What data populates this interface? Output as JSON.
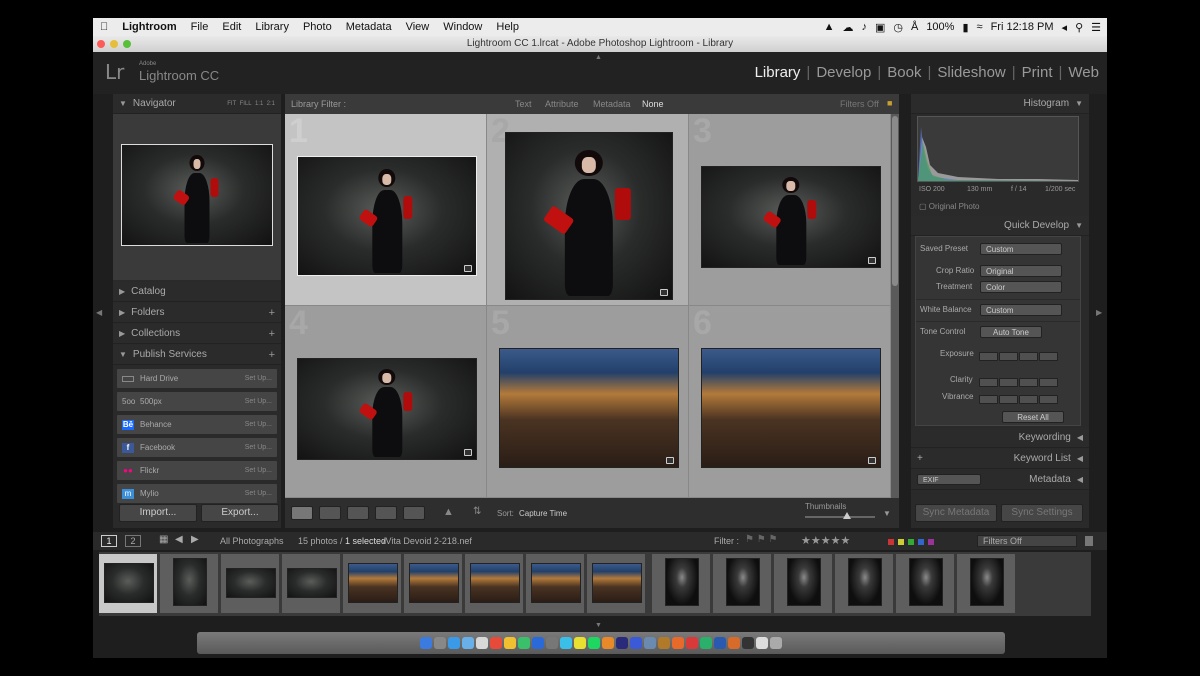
{
  "menubar": {
    "app": "Lightroom",
    "items": [
      "File",
      "Edit",
      "Library",
      "Photo",
      "Metadata",
      "View",
      "Window",
      "Help"
    ],
    "battery": "100%",
    "clock": "Fri 12:18 PM"
  },
  "window_title": "Lightroom CC 1.lrcat - Adobe Photoshop Lightroom - Library",
  "identity": {
    "logo": "Lr",
    "brand_small": "Adobe",
    "product": "Lightroom CC"
  },
  "modules": [
    "Library",
    "Develop",
    "Book",
    "Slideshow",
    "Print",
    "Web"
  ],
  "navigator": {
    "title": "Navigator",
    "zoom_options": [
      "FIT",
      "FILL",
      "1:1",
      "2:1"
    ]
  },
  "left_sections": [
    "Catalog",
    "Folders",
    "Collections",
    "Publish Services"
  ],
  "publish_services": [
    {
      "name": "Hard Drive",
      "action": "Set Up...",
      "icon": "hard-drive-icon",
      "color": "#888888"
    },
    {
      "name": "500px",
      "action": "Set Up...",
      "icon": "500px-icon",
      "color": "#999999"
    },
    {
      "name": "Behance",
      "action": "Set Up...",
      "icon": "behance-icon",
      "color": "#1769ff"
    },
    {
      "name": "Facebook",
      "action": "Set Up...",
      "icon": "facebook-icon",
      "color": "#3b5998"
    },
    {
      "name": "Flickr",
      "action": "Set Up...",
      "icon": "flickr-icon",
      "color": "#ff0084"
    },
    {
      "name": "Mylio",
      "action": "Set Up...",
      "icon": "mylio-icon",
      "color": "#3a8fd8"
    }
  ],
  "left_buttons": {
    "import": "Import...",
    "export": "Export..."
  },
  "filter_bar": {
    "label": "Library Filter :",
    "options": [
      "Text",
      "Attribute",
      "Metadata",
      "None"
    ],
    "active": "None",
    "filters_off": "Filters Off"
  },
  "grid_cells": [
    {
      "number": "1",
      "kind": "portrait",
      "selected": true
    },
    {
      "number": "2",
      "kind": "portrait",
      "selected": false
    },
    {
      "number": "3",
      "kind": "portrait",
      "selected": false
    },
    {
      "number": "4",
      "kind": "portrait",
      "selected": false
    },
    {
      "number": "5",
      "kind": "night",
      "selected": false
    },
    {
      "number": "6",
      "kind": "night",
      "selected": false
    }
  ],
  "toolbar": {
    "sort_label": "Sort:",
    "sort_value": "Capture Time",
    "thumbnails_label": "Thumbnails"
  },
  "histogram": {
    "title": "Histogram",
    "iso": "ISO 200",
    "focal": "130 mm",
    "aperture": "f / 14",
    "shutter": "1/200 sec",
    "original_photo": "Original Photo"
  },
  "quick_develop": {
    "title": "Quick Develop",
    "saved_preset_label": "Saved Preset",
    "saved_preset_value": "Custom",
    "crop_label": "Crop Ratio",
    "crop_value": "Original",
    "treatment_label": "Treatment",
    "treatment_value": "Color",
    "wb_label": "White Balance",
    "wb_value": "Custom",
    "tone_label": "Tone Control",
    "auto_tone": "Auto Tone",
    "exposure": "Exposure",
    "clarity": "Clarity",
    "vibrance": "Vibrance",
    "reset_all": "Reset All"
  },
  "right_sections": [
    "Keywording",
    "Keyword List",
    "Metadata"
  ],
  "metadata_preset": "EXIF",
  "sync": {
    "metadata": "Sync Metadata",
    "settings": "Sync Settings"
  },
  "filmstrip_bar": {
    "page1": "1",
    "page2": "2",
    "source": "All Photographs",
    "count": "15 photos /",
    "selected": "1 selected",
    "file": "/Vita Devoid 2-218.nef",
    "filter_label": "Filter :",
    "filters_off": "Filters Off"
  },
  "filmstrip": [
    {
      "kind": "portrait",
      "selected": true
    },
    {
      "kind": "portrait",
      "selected": false
    },
    {
      "kind": "portrait",
      "selected": false
    },
    {
      "kind": "portrait",
      "selected": false
    },
    {
      "kind": "night",
      "selected": false
    },
    {
      "kind": "night",
      "selected": false
    },
    {
      "kind": "night",
      "selected": false
    },
    {
      "kind": "night",
      "selected": false
    },
    {
      "kind": "night",
      "selected": false
    },
    {
      "kind": "man",
      "selected": false
    },
    {
      "kind": "man",
      "selected": false
    },
    {
      "kind": "man",
      "selected": false
    },
    {
      "kind": "man",
      "selected": false
    },
    {
      "kind": "man",
      "selected": false
    },
    {
      "kind": "man",
      "selected": false
    }
  ],
  "colors": {
    "accent": "#eeeeee",
    "panel": "#2a2a2a",
    "grid": "#9a9a9a",
    "selected_cell": "#c4c4c4"
  }
}
